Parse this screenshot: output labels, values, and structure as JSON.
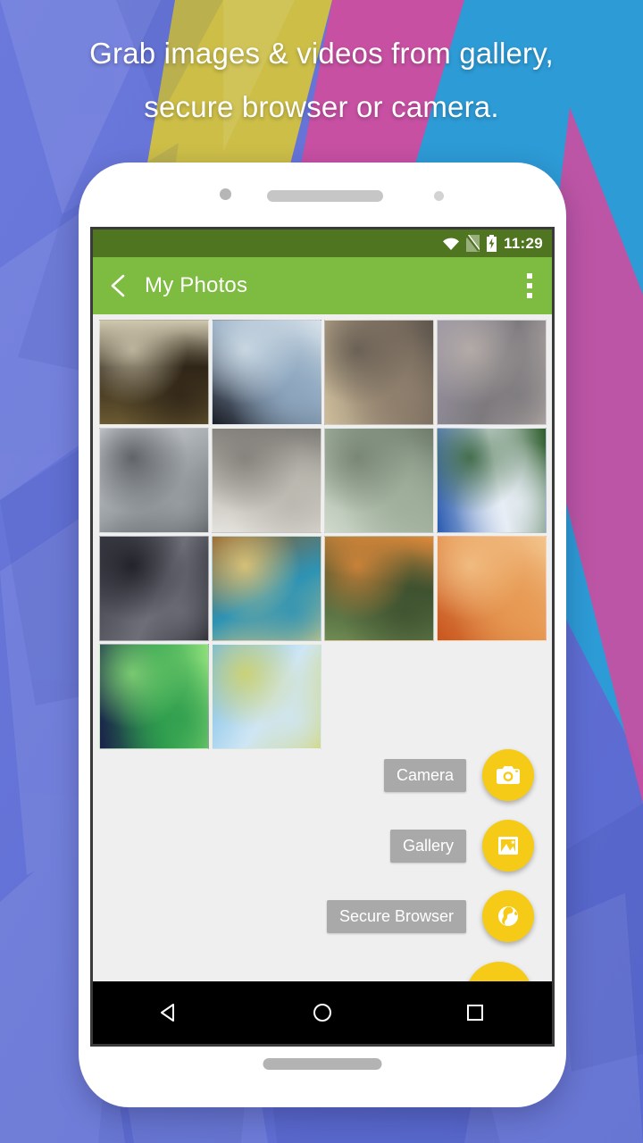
{
  "headline": {
    "line1": "Grab images & videos from gallery,",
    "line2": "secure browser or camera."
  },
  "colors": {
    "background": "#6272d8",
    "band_yellow": "#ccbe47",
    "band_pink": "#cc4ea0",
    "band_blue": "#2d9bd6",
    "statusbar_green": "#4f7520",
    "appbar_green": "#7ebb41",
    "fab_yellow": "#f5cb17",
    "chip_gray": "#a9a9a9",
    "screen_bg": "#efeff0"
  },
  "statusbar": {
    "clock": "11:29",
    "icons": [
      "wifi-icon",
      "no-sim-icon",
      "battery-charging-icon"
    ]
  },
  "appbar": {
    "back_icon": "back-chevron-icon",
    "title": "My Photos",
    "overflow_icon": "overflow-menu-icon"
  },
  "gallery": {
    "photos": [
      {
        "id": 1,
        "alt": "still-life-glasses",
        "c1": "#6a5a32",
        "c2": "#302618",
        "c3": "#cfc7ae"
      },
      {
        "id": 2,
        "alt": "space-station-orbit",
        "c1": "#1b1d26",
        "c2": "#8fa8c0",
        "c3": "#d7e2ea"
      },
      {
        "id": 3,
        "alt": "aerial-desert-terrain",
        "c1": "#cdbd9b",
        "c2": "#8f7f6d",
        "c3": "#5d554c"
      },
      {
        "id": 4,
        "alt": "mountain-observatory",
        "c1": "#9a94a5",
        "c2": "#7d7a7e",
        "c3": "#bdb4ad"
      },
      {
        "id": 5,
        "alt": "red-sportscar-road",
        "c1": "#d7dade",
        "c2": "#9aa0a4",
        "c3": "#4b4e52"
      },
      {
        "id": 6,
        "alt": "red-supercar-salt-flat",
        "c1": "#e4e2dc",
        "c2": "#b9b6ae",
        "c3": "#7e7c76"
      },
      {
        "id": 7,
        "alt": "red-car-billboard",
        "c1": "#cfd9cc",
        "c2": "#9fae9b",
        "c3": "#6f7c6c"
      },
      {
        "id": 8,
        "alt": "rocket-launch-reflection",
        "c1": "#2a5bb0",
        "c2": "#e8eef6",
        "c3": "#2d5c2a"
      },
      {
        "id": 9,
        "alt": "observatory-milky-way",
        "c1": "#3b3c46",
        "c2": "#6d6e78",
        "c3": "#16171d"
      },
      {
        "id": 10,
        "alt": "sea-cave-sunset",
        "c1": "#8c5724",
        "c2": "#2e93b4",
        "c3": "#f3d27a"
      },
      {
        "id": 11,
        "alt": "baseball-park-player",
        "c1": "#6f8b53",
        "c2": "#3f5230",
        "c3": "#e08a3a"
      },
      {
        "id": 12,
        "alt": "sandstone-wave-canyon",
        "c1": "#c8551f",
        "c2": "#e79a54",
        "c3": "#f3c48c"
      },
      {
        "id": 13,
        "alt": "dew-drops-green-leaf",
        "c1": "#19214a",
        "c2": "#2f9e4e",
        "c3": "#8ee07a"
      },
      {
        "id": 14,
        "alt": "yellow-flowers-blue-sky",
        "c1": "#6fb8e6",
        "c2": "#cfe6f4",
        "c3": "#d4d25a"
      }
    ]
  },
  "fab_menu": {
    "items": [
      {
        "label": "Camera",
        "icon": "camera-icon",
        "name": "camera"
      },
      {
        "label": "Gallery",
        "icon": "image-icon",
        "name": "gallery"
      },
      {
        "label": "Secure Browser",
        "icon": "globe-icon",
        "name": "secure-browser"
      }
    ],
    "close_icon": "close-icon"
  },
  "navbar": {
    "back": "nav-back-icon",
    "home": "nav-home-icon",
    "recents": "nav-recents-icon"
  }
}
